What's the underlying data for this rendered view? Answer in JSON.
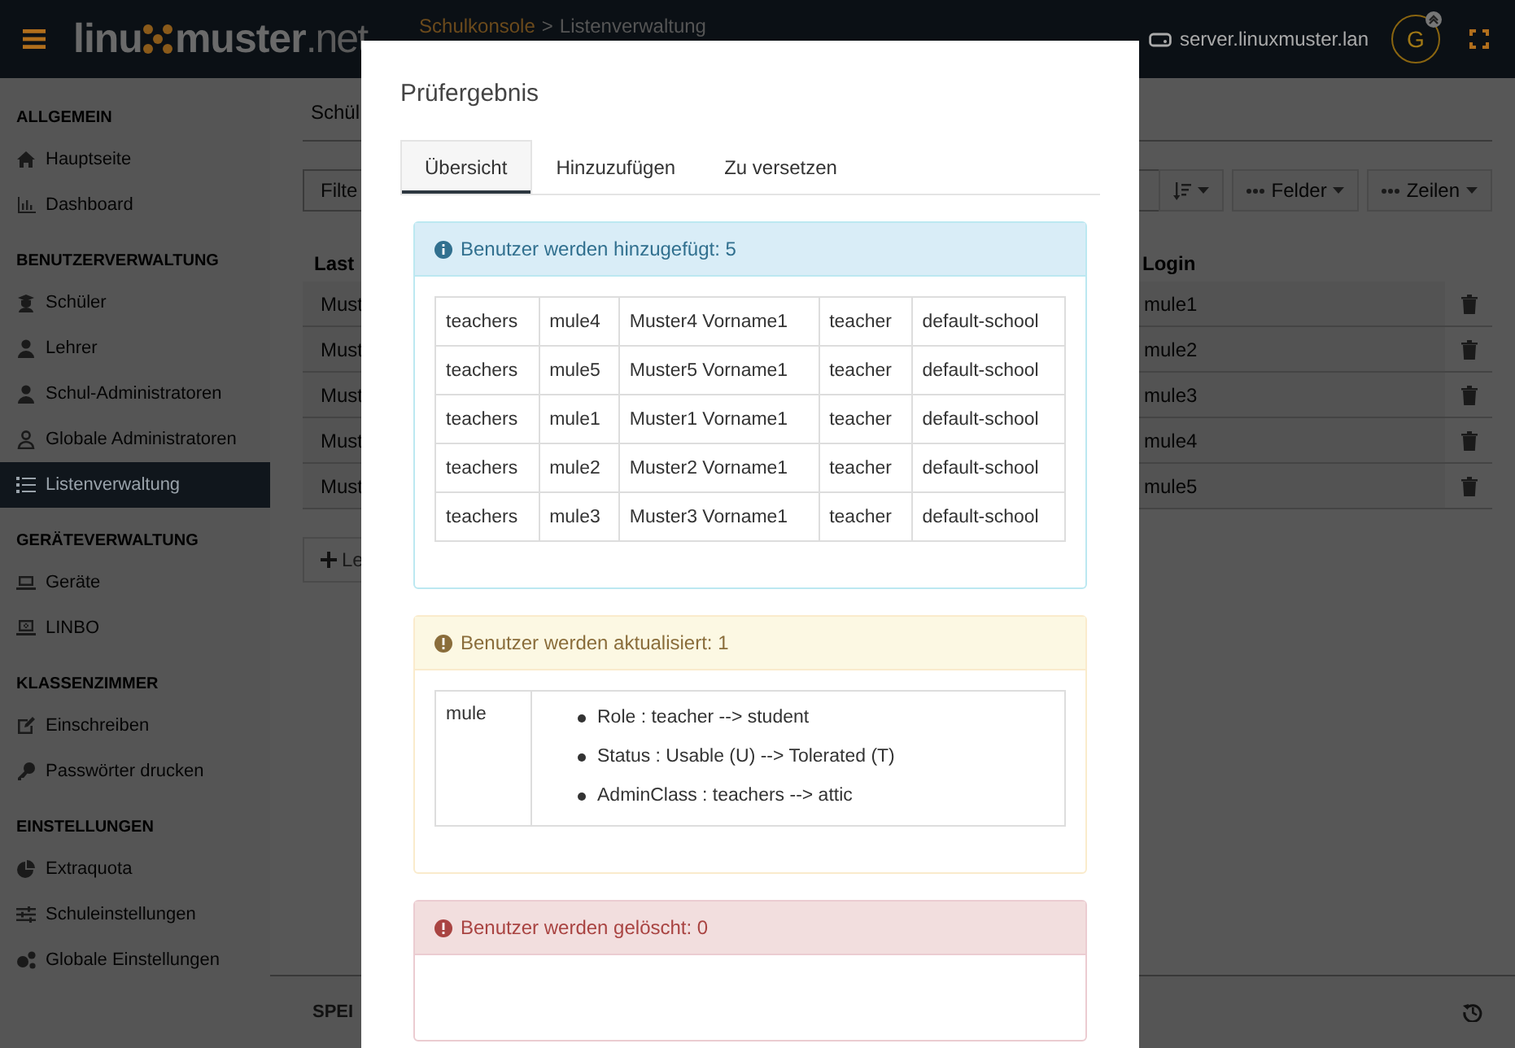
{
  "header": {
    "logo": {
      "left": "linu",
      "right": "muster",
      "suffix": ".net"
    },
    "breadcrumb": {
      "root": "Schulkonsole",
      "separator": ">",
      "current": "Listenverwaltung"
    },
    "server": "server.linuxmuster.lan",
    "avatar": "G"
  },
  "sidebar": {
    "sections": [
      {
        "title": "ALLGEMEIN",
        "items": [
          {
            "label": "Hauptseite",
            "selected": false
          },
          {
            "label": "Dashboard",
            "selected": false
          }
        ]
      },
      {
        "title": "BENUTZERVERWALTUNG",
        "items": [
          {
            "label": "Schüler",
            "selected": false
          },
          {
            "label": "Lehrer",
            "selected": false
          },
          {
            "label": "Schul-Administratoren",
            "selected": false
          },
          {
            "label": "Globale Administratoren",
            "selected": false
          },
          {
            "label": "Listenverwaltung",
            "selected": true
          }
        ]
      },
      {
        "title": "GERÄTEVERWALTUNG",
        "items": [
          {
            "label": "Geräte",
            "selected": false
          },
          {
            "label": "LINBO",
            "selected": false
          }
        ]
      },
      {
        "title": "KLASSENZIMMER",
        "items": [
          {
            "label": "Einschreiben",
            "selected": false
          },
          {
            "label": "Passwörter drucken",
            "selected": false
          }
        ]
      },
      {
        "title": "EINSTELLUNGEN",
        "items": [
          {
            "label": "Extraquota",
            "selected": false
          },
          {
            "label": "Schuleinstellungen",
            "selected": false
          },
          {
            "label": "Globale Einstellungen",
            "selected": false
          }
        ]
      }
    ]
  },
  "main": {
    "heading": "Schül",
    "filter": {
      "placeholder": "Filte"
    },
    "toolbar": [
      {
        "kind": "sort"
      },
      {
        "kind": "menu",
        "label": "Felder"
      },
      {
        "kind": "menu",
        "label": "Zeilen"
      }
    ],
    "table": {
      "columns": [
        "Last",
        "Login"
      ],
      "rows": [
        {
          "last_name": "Must",
          "login": "mule1"
        },
        {
          "last_name": "Must",
          "login": "mule2"
        },
        {
          "last_name": "Must",
          "login": "mule3"
        },
        {
          "last_name": "Must",
          "login": "mule4"
        },
        {
          "last_name": "Must",
          "login": "mule5"
        }
      ]
    },
    "add_button": "Le",
    "footer": "SPEI"
  },
  "modal": {
    "title": "Prüfergebnis",
    "tabs": [
      {
        "label": "Übersicht",
        "selected": true
      },
      {
        "label": "Hinzuzufügen",
        "selected": false
      },
      {
        "label": "Zu versetzen",
        "selected": false
      }
    ],
    "panels": [
      {
        "kind": "info",
        "title": "Benutzer werden hinzugefügt: 5",
        "rows": [
          [
            "teachers",
            "mule4",
            "Muster4 Vorname1",
            "teacher",
            "default-school"
          ],
          [
            "teachers",
            "mule5",
            "Muster5 Vorname1",
            "teacher",
            "default-school"
          ],
          [
            "teachers",
            "mule1",
            "Muster1 Vorname1",
            "teacher",
            "default-school"
          ],
          [
            "teachers",
            "mule2",
            "Muster2 Vorname1",
            "teacher",
            "default-school"
          ],
          [
            "teachers",
            "mule3",
            "Muster3 Vorname1",
            "teacher",
            "default-school"
          ]
        ]
      },
      {
        "kind": "warning",
        "title": "Benutzer werden aktualisiert: 1",
        "changes": [
          {
            "user": "mule",
            "items": [
              "Role : teacher --> student",
              "Status : Usable (U) --> Tolerated (T)",
              "AdminClass : teachers --> attic"
            ]
          }
        ]
      },
      {
        "kind": "danger",
        "title": "Benutzer werden gelöscht: 0"
      }
    ]
  }
}
